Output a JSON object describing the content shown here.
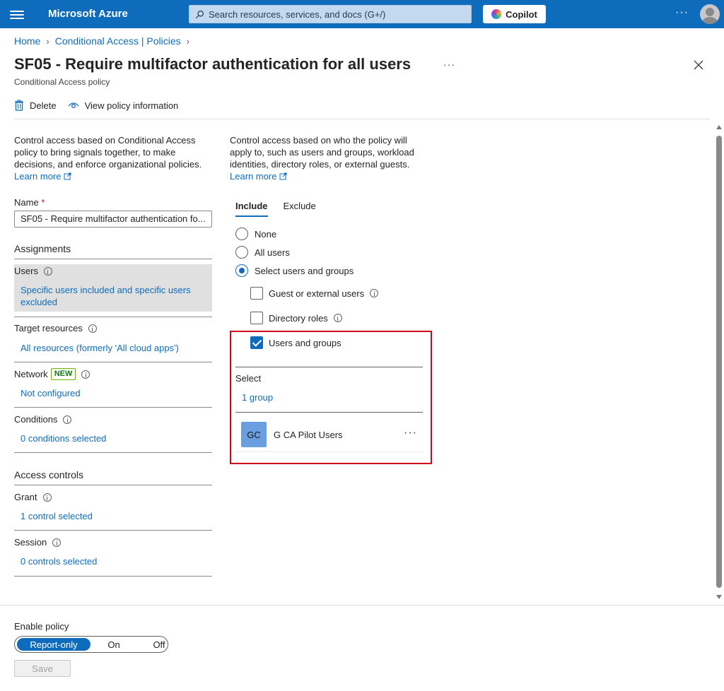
{
  "topbar": {
    "brand": "Microsoft Azure",
    "search_placeholder": "Search resources, services, and docs (G+/)",
    "copilot_label": "Copilot",
    "more": "···"
  },
  "breadcrumb": [
    "Home",
    "Conditional Access | Policies"
  ],
  "page": {
    "title": "SF05 - Require multifactor authentication for all users",
    "subtitle": "Conditional Access policy",
    "more": "···"
  },
  "toolbar": {
    "delete_label": "Delete",
    "view_info_label": "View policy information"
  },
  "left": {
    "description": "Control access based on Conditional Access policy to bring signals together, to make decisions, and enforce organizational policies.",
    "learn_more": "Learn more",
    "name_label": "Name",
    "required_mark": "*",
    "name_value": "SF05 - Require multifactor authentication fo...",
    "assignments_heading": "Assignments",
    "users_label": "Users",
    "users_value": "Specific users included and specific users excluded",
    "target_label": "Target resources",
    "target_value": "All resources (formerly 'All cloud apps')",
    "network_label": "Network",
    "network_badge": "NEW",
    "network_value": "Not configured",
    "conditions_label": "Conditions",
    "conditions_value": "0 conditions selected",
    "access_heading": "Access controls",
    "grant_label": "Grant",
    "grant_value": "1 control selected",
    "session_label": "Session",
    "session_value": "0 controls selected"
  },
  "right": {
    "description": "Control access based on who the policy will apply to, such as users and groups, workload identities, directory roles, or external guests.",
    "learn_more": "Learn more",
    "tabs": [
      "Include",
      "Exclude"
    ],
    "radios": [
      "None",
      "All users",
      "Select users and groups"
    ],
    "selected_radio": "Select users and groups",
    "checkboxes": {
      "guest": "Guest or external users",
      "directory": "Directory roles",
      "users_groups": "Users and groups"
    },
    "select_label": "Select",
    "group_count": "1 group",
    "group": {
      "initials": "GC",
      "name": "G CA Pilot Users",
      "more": "···"
    }
  },
  "footer": {
    "enable_label": "Enable policy",
    "options": [
      "Report-only",
      "On",
      "Off"
    ],
    "selected": "Report-only",
    "save_label": "Save"
  },
  "colors": {
    "accent": "#0f6cbd",
    "highlight_border": "#d0021b"
  }
}
